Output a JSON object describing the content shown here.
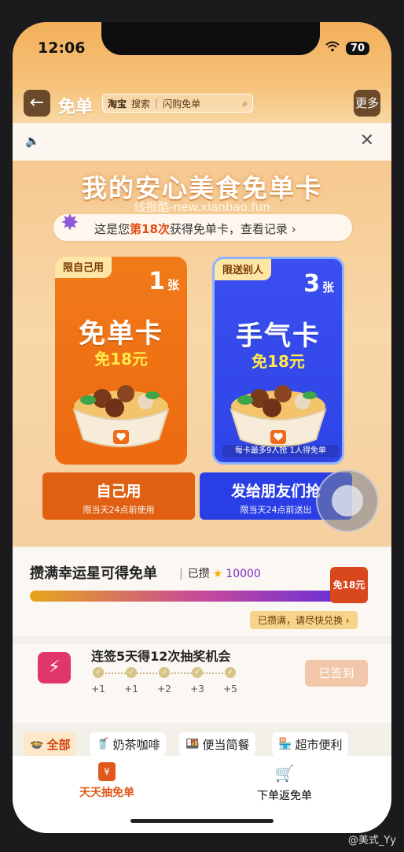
{
  "status": {
    "time": "12:06",
    "battery": "70"
  },
  "nav": {
    "title": "免单",
    "search_brand": "淘宝",
    "search_action": "搜索",
    "search_query": "闪购免单",
    "more": "更多"
  },
  "hero": {
    "title": "我的安心美食免单卡",
    "watermark": "线报酷-new.xianbao.fun",
    "record_prefix": "这是您",
    "record_count": "第18次",
    "record_suffix": "获得免单卡，查看记录 ›"
  },
  "cards": [
    {
      "tag": "限自己用",
      "count": "1",
      "unit": "张",
      "name": "免单卡",
      "sub": "免18元",
      "note": ""
    },
    {
      "tag": "限送别人",
      "count": "3",
      "unit": "张",
      "name": "手气卡",
      "sub": "免18元",
      "note": "每卡最多9人抢 1人得免单"
    }
  ],
  "actions": [
    {
      "label": "自己用",
      "sub": "限当天24点前使用"
    },
    {
      "label": "发给朋友们抢",
      "sub": "限当天24点前送出"
    }
  ],
  "lucky": {
    "title": "攒满幸运星可得免单",
    "got_label": "已攒",
    "got_value": "10000",
    "progress": 1.0,
    "reward": "免18元",
    "redeem": "已攒满，请尽快兑换 ›"
  },
  "signin": {
    "title": "连签5天得12次抽奖机会",
    "days": [
      "+1",
      "+1",
      "+2",
      "+3",
      "+5"
    ],
    "button": "已签到"
  },
  "categories": [
    {
      "label": "全部",
      "icon": "bowl-icon",
      "active": true
    },
    {
      "label": "奶茶咖啡",
      "icon": "cup-icon",
      "active": false
    },
    {
      "label": "便当简餐",
      "icon": "bento-icon",
      "active": false
    },
    {
      "label": "超市便利",
      "icon": "store-icon",
      "active": false
    }
  ],
  "bottom_nav": [
    {
      "label": "天天抽免单",
      "icon": "gift-icon",
      "active": true
    },
    {
      "label": "下单返免单",
      "icon": "cart-icon",
      "active": false
    }
  ],
  "footer": {
    "weibo": "@美式_Yy"
  },
  "colors": {
    "orange": "#ee6a10",
    "blue": "#2f44e6",
    "accent_red": "#e34b14"
  }
}
